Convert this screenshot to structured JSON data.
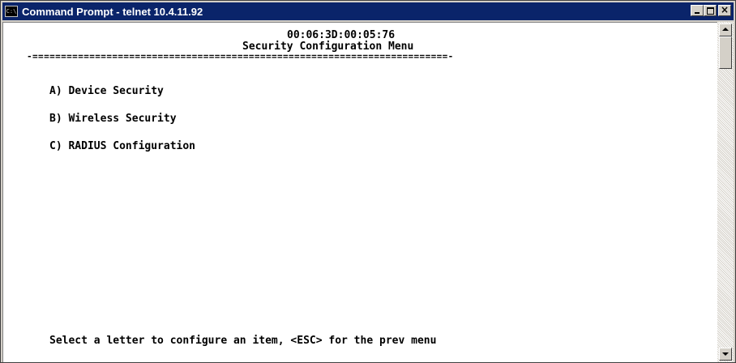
{
  "window": {
    "title": "Command Prompt - telnet 10.4.11.92",
    "icon": "console-icon",
    "buttons": {
      "minimize": "minimize-icon",
      "maximize": "maximize-icon",
      "close": "close-icon",
      "close_glyph": "×"
    }
  },
  "terminal": {
    "mac_address": "00:06:3D:00:05:76",
    "menu_title": "Security Configuration Menu",
    "separator": "-=========================================================================-",
    "menu_items": [
      {
        "key": "A",
        "text": "A) Device Security"
      },
      {
        "key": "B",
        "text": "B) Wireless Security"
      },
      {
        "key": "C",
        "text": "C) RADIUS Configuration"
      }
    ],
    "prompt": "Select a letter to configure an item, <ESC> for the prev menu"
  },
  "colors": {
    "titlebar": "#0a246a",
    "console_bg": "#ffffff",
    "console_text": "#000000",
    "chrome": "#d4d0c8"
  }
}
